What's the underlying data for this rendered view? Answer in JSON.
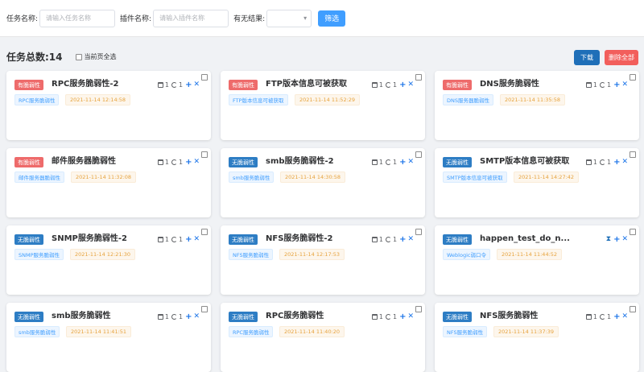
{
  "filter": {
    "task_name_label": "任务名称:",
    "task_name_placeholder": "请输入任务名称",
    "plugin_name_label": "插件名称:",
    "plugin_name_placeholder": "请输入插件名称",
    "result_label": "有无结果:",
    "result_value": "",
    "filter_button": "筛选"
  },
  "summary": {
    "total_label": "任务总数:14",
    "select_all_label": "当前页全选"
  },
  "actions": {
    "download": "下载",
    "delete_all": "删除全部"
  },
  "colors": {
    "primary": "#409eff",
    "download": "#1f6fb8",
    "danger": "#f25f5c",
    "vuln_badge": "#ee6b6b",
    "no_vuln_badge": "#2d7dc4"
  },
  "cards": [
    {
      "status": "有脆弱性",
      "kind": "vuln",
      "title": "RPC服务脆弱性-2",
      "plugin": "RPC服务脆弱性",
      "time": "2021-11-14 12:14:58",
      "tools": {
        "a": "1",
        "b": "1"
      }
    },
    {
      "status": "有脆弱性",
      "kind": "vuln",
      "title": "FTP版本信息可被获取",
      "plugin": "FTP版本信息可被获取",
      "time": "2021-11-14 11:52:29",
      "tools": {
        "a": "1",
        "b": "1"
      }
    },
    {
      "status": "有脆弱性",
      "kind": "vuln",
      "title": "DNS服务脆弱性",
      "plugin": "DNS服务器脆弱性",
      "time": "2021-11-14 11:35:58",
      "tools": {
        "a": "1",
        "b": "1"
      }
    },
    {
      "status": "有脆弱性",
      "kind": "vuln",
      "title": "邮件服务器脆弱性",
      "plugin": "邮件服务器脆弱性",
      "time": "2021-11-14 11:32:08",
      "tools": {
        "a": "1",
        "b": "1"
      }
    },
    {
      "status": "无脆弱性",
      "kind": "none",
      "title": "smb服务脆弱性-2",
      "plugin": "smb服务脆弱性",
      "time": "2021-11-14 14:30:58",
      "tools": {
        "a": "1",
        "b": "1"
      }
    },
    {
      "status": "无脆弱性",
      "kind": "none",
      "title": "SMTP版本信息可被获取",
      "plugin": "SMTP版本信息可被获取",
      "time": "2021-11-14 14:27:42",
      "tools": {
        "a": "1",
        "b": "1"
      }
    },
    {
      "status": "无脆弱性",
      "kind": "none",
      "title": "SNMP服务脆弱性-2",
      "plugin": "SNMP服务脆弱性",
      "time": "2021-11-14 12:21:30",
      "tools": {
        "a": "1",
        "b": "1"
      }
    },
    {
      "status": "无脆弱性",
      "kind": "none",
      "title": "NFS服务脆弱性-2",
      "plugin": "NFS服务脆弱性",
      "time": "2021-11-14 12:17:53",
      "tools": {
        "a": "1",
        "b": "1"
      }
    },
    {
      "status": "无脆弱性",
      "kind": "none",
      "title": "happen_test_do_n...",
      "plugin": "Weblogic弱口令",
      "time": "2021-11-14 11:44:52",
      "tools": null
    },
    {
      "status": "无脆弱性",
      "kind": "none",
      "title": "smb服务脆弱性",
      "plugin": "smb服务脆弱性",
      "time": "2021-11-14 11:41:51",
      "tools": {
        "a": "1",
        "b": "1"
      }
    },
    {
      "status": "无脆弱性",
      "kind": "none",
      "title": "RPC服务脆弱性",
      "plugin": "RPC服务脆弱性",
      "time": "2021-11-14 11:40:20",
      "tools": {
        "a": "1",
        "b": "1"
      }
    },
    {
      "status": "无脆弱性",
      "kind": "none",
      "title": "NFS服务脆弱性",
      "plugin": "NFS服务脆弱性",
      "time": "2021-11-14 11:37:39",
      "tools": {
        "a": "1",
        "b": "1"
      }
    }
  ]
}
